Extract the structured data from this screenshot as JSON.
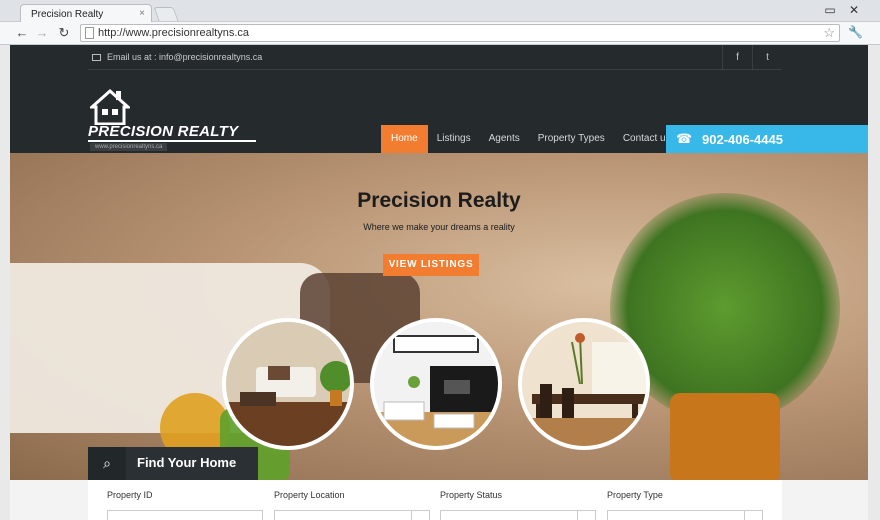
{
  "browser": {
    "tab_title": "Precision Realty",
    "tab_close": "×",
    "url": "http://www.precisionrealtyns.ca",
    "minimize": "▭",
    "close": "✕",
    "back": "←",
    "forward": "→",
    "reload": "↻",
    "star": "☆",
    "wrench": "🔧"
  },
  "header": {
    "email_text": "Email us at : info@precisionrealtyns.ca",
    "social": {
      "facebook": "f",
      "twitter": "t"
    },
    "logo_text": "PRECISION REALTY",
    "logo_url": "www.precisionrealtyns.ca",
    "nav": [
      "Home",
      "Listings",
      "Agents",
      "Property Types",
      "Contact us"
    ],
    "phone": "902-406-4445",
    "phone_icon": "☎"
  },
  "hero": {
    "title": "Precision Realty",
    "subtitle": "Where we make your dreams a reality",
    "button": "VIEW LISTINGS"
  },
  "search": {
    "heading": "Find Your Home",
    "icon": "⌕",
    "fields": [
      "Property ID",
      "Property Location",
      "Property Status",
      "Property Type"
    ]
  },
  "colors": {
    "accent": "#f27c2f",
    "phone_bg": "#38b8e8",
    "header_bg": "#252a2d"
  }
}
